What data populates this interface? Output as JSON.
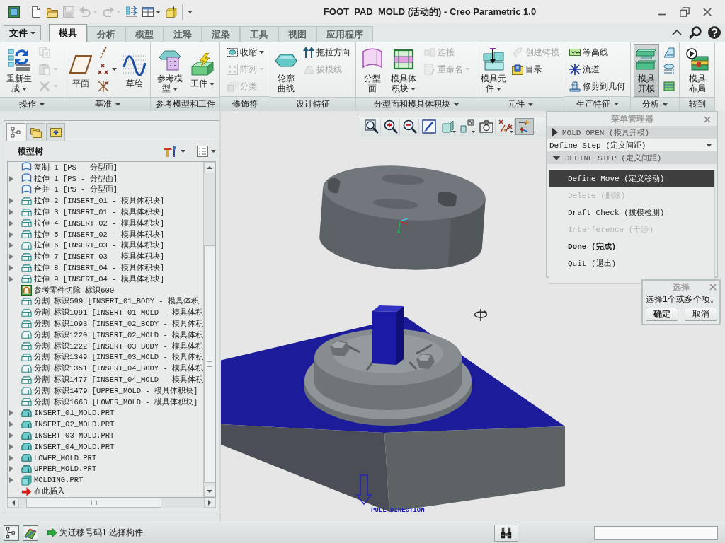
{
  "window": {
    "title": "FOOT_PAD_MOLD (活动的) - Creo Parametric 1.0"
  },
  "quick_access": [
    {
      "disabled": false,
      "dropdown": false
    },
    {
      "disabled": false,
      "dropdown": false
    },
    {
      "disabled": true,
      "dropdown": false
    },
    {
      "disabled": true,
      "dropdown": true
    },
    {
      "disabled": true,
      "dropdown": true
    },
    {
      "disabled": false,
      "dropdown": false
    },
    {
      "disabled": false,
      "dropdown": true
    },
    {
      "disabled": false,
      "dropdown": false
    }
  ],
  "tabs": [
    {
      "kind": "file",
      "label": "文件",
      "selected": false
    },
    {
      "kind": "tab",
      "label": "模具",
      "selected": true
    },
    {
      "kind": "tab",
      "label": "分析",
      "selected": false
    },
    {
      "kind": "tab",
      "label": "模型",
      "selected": false
    },
    {
      "kind": "tab",
      "label": "注释",
      "selected": false
    },
    {
      "kind": "tab",
      "label": "渲染",
      "selected": false
    },
    {
      "kind": "tab",
      "label": "工具",
      "selected": false
    },
    {
      "kind": "tab",
      "label": "视图",
      "selected": false
    },
    {
      "kind": "tab",
      "label": "应用程序",
      "selected": false
    }
  ],
  "ribbon": [
    {
      "label": "操作",
      "dropdown": true,
      "items": [
        {
          "kind": "large",
          "label": "重新生成",
          "dropdown": true,
          "disabled": false,
          "pressed": false
        },
        {
          "kind": "icon",
          "dropdown": false,
          "disabled": true,
          "pressed": false
        },
        {
          "kind": "icon",
          "dropdown": true,
          "disabled": true,
          "pressed": false
        },
        {
          "kind": "icon",
          "dropdown": true,
          "disabled": true,
          "pressed": false
        }
      ]
    },
    {
      "label": "基准",
      "dropdown": true,
      "items": [
        {
          "kind": "large",
          "label": "平面",
          "dropdown": false,
          "disabled": false,
          "pressed": false
        },
        {
          "kind": "icon",
          "dropdown": false,
          "disabled": false,
          "pressed": false
        },
        {
          "kind": "icon",
          "dropdown": true,
          "disabled": false,
          "pressed": false
        },
        {
          "kind": "icon",
          "dropdown": false,
          "disabled": false,
          "pressed": false
        },
        {
          "kind": "large",
          "label": "草绘",
          "dropdown": false,
          "disabled": false,
          "pressed": false
        }
      ]
    },
    {
      "label": "参考模型和工件",
      "dropdown": false,
      "items": [
        {
          "kind": "large",
          "label": "参考模型",
          "dropdown": true,
          "disabled": false,
          "pressed": false
        },
        {
          "kind": "large",
          "label": "工件",
          "dropdown": true,
          "disabled": false,
          "pressed": false
        }
      ]
    },
    {
      "label": "修饰符",
      "dropdown": false,
      "items": [
        {
          "kind": "small",
          "label": "收缩",
          "dropdown": true,
          "disabled": false,
          "pressed": false
        },
        {
          "kind": "small",
          "label": "阵列",
          "dropdown": true,
          "disabled": true,
          "pressed": false
        },
        {
          "kind": "small",
          "label": "分类",
          "dropdown": false,
          "disabled": true,
          "pressed": false
        }
      ]
    },
    {
      "label": "设计特征",
      "dropdown": false,
      "items": [
        {
          "kind": "large",
          "label": "轮廓曲线",
          "dropdown": false,
          "disabled": false,
          "pressed": false
        },
        {
          "kind": "small",
          "label": "拖拉方向",
          "dropdown": false,
          "disabled": false,
          "pressed": false
        },
        {
          "kind": "small",
          "label": "拔模线",
          "dropdown": false,
          "disabled": true,
          "pressed": false
        }
      ]
    },
    {
      "label": "分型面和模具体积块",
      "dropdown": true,
      "items": [
        {
          "kind": "large",
          "label": "分型面",
          "dropdown": false,
          "disabled": false,
          "pressed": false
        },
        {
          "kind": "large",
          "label": "模具体积块",
          "dropdown": true,
          "disabled": false,
          "pressed": false
        },
        {
          "kind": "small",
          "label": "连接",
          "dropdown": false,
          "disabled": true,
          "pressed": false
        },
        {
          "kind": "small",
          "label": "重命名",
          "dropdown": true,
          "disabled": true,
          "pressed": false
        }
      ]
    },
    {
      "label": "元件",
      "dropdown": true,
      "items": [
        {
          "kind": "large",
          "label": "模具元件",
          "dropdown": true,
          "disabled": false,
          "pressed": false
        },
        {
          "kind": "small",
          "label": "创建铸模",
          "dropdown": false,
          "disabled": true,
          "pressed": false
        },
        {
          "kind": "small",
          "label": "目录",
          "dropdown": false,
          "disabled": false,
          "pressed": false
        }
      ]
    },
    {
      "label": "生产特征",
      "dropdown": true,
      "items": [
        {
          "kind": "small",
          "label": "等高线",
          "dropdown": false,
          "disabled": false,
          "pressed": false
        },
        {
          "kind": "small",
          "label": "流道",
          "dropdown": false,
          "disabled": false,
          "pressed": false
        },
        {
          "kind": "small",
          "label": "修剪到几何",
          "dropdown": false,
          "disabled": false,
          "pressed": false
        }
      ]
    },
    {
      "label": "分析",
      "dropdown": true,
      "items": [
        {
          "kind": "large",
          "label": "模具开模",
          "dropdown": false,
          "disabled": false,
          "pressed": true
        },
        {
          "kind": "icon",
          "dropdown": false,
          "disabled": false,
          "pressed": false
        },
        {
          "kind": "icon",
          "dropdown": false,
          "disabled": false,
          "pressed": false
        },
        {
          "kind": "icon",
          "dropdown": false,
          "disabled": false,
          "pressed": false
        }
      ]
    },
    {
      "label": "转到",
      "dropdown": false,
      "items": [
        {
          "kind": "large",
          "label": "模具布局",
          "dropdown": false,
          "disabled": false,
          "pressed": false
        }
      ]
    }
  ],
  "view_toolbar": [
    {
      "dropdown": false,
      "pressed": false
    },
    {
      "dropdown": false,
      "pressed": false
    },
    {
      "dropdown": false,
      "pressed": false
    },
    {
      "dropdown": false,
      "pressed": false
    },
    {
      "dropdown": true,
      "pressed": false
    },
    {
      "dropdown": true,
      "pressed": false
    },
    {
      "dropdown": false,
      "pressed": false
    },
    {
      "dropdown": true,
      "pressed": false
    },
    {
      "dropdown": false,
      "pressed": true
    }
  ],
  "model_tree": {
    "tabs": [
      {
        "selected": true
      },
      {
        "selected": false
      },
      {
        "selected": false
      }
    ],
    "title": "模型树",
    "items": [
      {
        "kind": "surface",
        "label": "复制 1 [PS - 分型面]",
        "expandable": false
      },
      {
        "kind": "surface",
        "label": "拉伸 1 [PS - 分型面]",
        "expandable": true
      },
      {
        "kind": "surface",
        "label": "合并 1 [PS - 分型面]",
        "expandable": false
      },
      {
        "kind": "volume",
        "label": "拉伸 2 [INSERT_01 - 模具体积块]",
        "expandable": true
      },
      {
        "kind": "volume",
        "label": "拉伸 3 [INSERT_01 - 模具体积块]",
        "expandable": true
      },
      {
        "kind": "volume",
        "label": "拉伸 4 [INSERT_02 - 模具体积块]",
        "expandable": true
      },
      {
        "kind": "volume",
        "label": "拉伸 5 [INSERT_02 - 模具体积块]",
        "expandable": true
      },
      {
        "kind": "volume",
        "label": "拉伸 6 [INSERT_03 - 模具体积块]",
        "expandable": true
      },
      {
        "kind": "volume",
        "label": "拉伸 7 [INSERT_03 - 模具体积块]",
        "expandable": true
      },
      {
        "kind": "volume",
        "label": "拉伸 8 [INSERT_04 - 模具体积块]",
        "expandable": true
      },
      {
        "kind": "volume",
        "label": "拉伸 9 [INSERT_04 - 模具体积块]",
        "expandable": true
      },
      {
        "kind": "cut",
        "label": "参考零件切除 标识600",
        "expandable": false
      },
      {
        "kind": "volume",
        "label": "分割 标识599 [INSERT_01_BODY - 模具体积",
        "expandable": false
      },
      {
        "kind": "volume",
        "label": "分割 标识1091 [INSERT_01_MOLD - 模具体积",
        "expandable": false
      },
      {
        "kind": "volume",
        "label": "分割 标识1093 [INSERT_02_BODY - 模具体积",
        "expandable": false
      },
      {
        "kind": "volume",
        "label": "分割 标识1220 [INSERT_02_MOLD - 模具体积",
        "expandable": false
      },
      {
        "kind": "volume",
        "label": "分割 标识1222 [INSERT_03_BODY - 模具体积",
        "expandable": false
      },
      {
        "kind": "volume",
        "label": "分割 标识1349 [INSERT_03_MOLD - 模具体积",
        "expandable": false
      },
      {
        "kind": "volume",
        "label": "分割 标识1351 [INSERT_04_BODY - 模具体积",
        "expandable": false
      },
      {
        "kind": "volume",
        "label": "分割 标识1477 [INSERT_04_MOLD - 模具体积",
        "expandable": false
      },
      {
        "kind": "volume",
        "label": "分割 标识1479 [UPPER_MOLD - 模具体积块]",
        "expandable": false
      },
      {
        "kind": "volume",
        "label": "分割 标识1663 [LOWER_MOLD - 模具体积块]",
        "expandable": false
      },
      {
        "kind": "part",
        "label": "INSERT_01_MOLD.PRT",
        "expandable": true
      },
      {
        "kind": "part",
        "label": "INSERT_02_MOLD.PRT",
        "expandable": true
      },
      {
        "kind": "part",
        "label": "INSERT_03_MOLD.PRT",
        "expandable": true
      },
      {
        "kind": "part",
        "label": "INSERT_04_MOLD.PRT",
        "expandable": true
      },
      {
        "kind": "part",
        "label": "LOWER_MOLD.PRT",
        "expandable": true
      },
      {
        "kind": "part",
        "label": "UPPER_MOLD.PRT",
        "expandable": true
      },
      {
        "kind": "workpiece",
        "label": "MOLDING.PRT",
        "expandable": true
      },
      {
        "kind": "insert",
        "label": "在此插入",
        "expandable": false
      }
    ]
  },
  "graphics": {
    "pull_direction_label": "PULL DIRECTION"
  },
  "menu_manager": {
    "title": "菜单管理器",
    "sections": [
      {
        "kind": "header",
        "label": "MOLD OPEN (模具开模)",
        "expanded": false
      },
      {
        "kind": "selector",
        "label": "Define Step (定义间距)"
      },
      {
        "kind": "header",
        "label": "DEFINE STEP (定义间距)",
        "expanded": true,
        "items": [
          {
            "label": "Define Move (定义移动)",
            "selected": true,
            "disabled": false,
            "default": false
          },
          {
            "label": "Delete (删除)",
            "selected": false,
            "disabled": true,
            "default": false
          },
          {
            "label": "Draft Check (拔模检测)",
            "selected": false,
            "disabled": false,
            "default": false
          },
          {
            "label": "Interference (干涉)",
            "selected": false,
            "disabled": true,
            "default": false
          },
          {
            "label": "Done (完成)",
            "selected": false,
            "disabled": false,
            "default": true
          },
          {
            "label": "Quit (退出)",
            "selected": false,
            "disabled": false,
            "default": false
          }
        ]
      }
    ]
  },
  "select_dialog": {
    "title": "选择",
    "message": "选择1个或多个项。",
    "buttons": [
      {
        "label": "确定",
        "default": true
      },
      {
        "label": "取消",
        "default": false
      }
    ]
  },
  "status_bar": {
    "prompt": "为迁移号码1 选择构件"
  }
}
